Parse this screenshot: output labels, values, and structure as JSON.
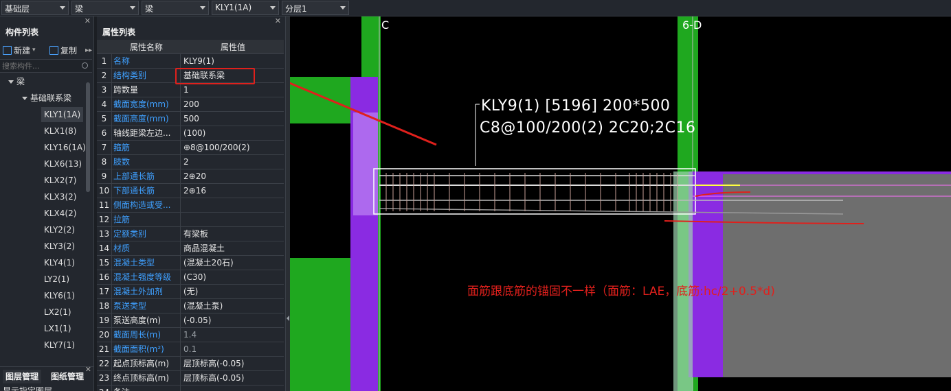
{
  "toolbar": {
    "floor": "基础层",
    "type": "梁",
    "subtype": "梁",
    "component": "KLY1(1A)",
    "layer": "分层1"
  },
  "component_panel": {
    "title": "构件列表",
    "new_label": "新建",
    "copy_label": "复制",
    "search_placeholder": "搜索构件...",
    "tree_root": "梁",
    "tree_group": "基础联系梁",
    "items": [
      "KLY1(1A)",
      "KLX1(8)",
      "KLY16(1A)",
      "KLX6(13)",
      "KLX2(7)",
      "KLX3(2)",
      "KLX4(2)",
      "KLY2(2)",
      "KLY3(2)",
      "KLY4(1)",
      "LY2(1)",
      "KLY6(1)",
      "LX2(1)",
      "LX1(1)",
      "KLY7(1)"
    ],
    "selected_item": "KLY1(1A)"
  },
  "bottom_tabs": {
    "tab1": "图层管理",
    "tab2": "图纸管理",
    "partial": "显示指定图层"
  },
  "property_panel": {
    "title": "属性列表",
    "col_name": "属性名称",
    "col_value": "属性值",
    "rows": [
      {
        "num": "1",
        "name": "名称",
        "value": "KLY9(1)",
        "name_blue": true
      },
      {
        "num": "2",
        "name": "结构类别",
        "value": "基础联系梁",
        "name_blue": true
      },
      {
        "num": "3",
        "name": "跨数量",
        "value": "1",
        "name_blue": false
      },
      {
        "num": "4",
        "name": "截面宽度(mm)",
        "value": "200",
        "name_blue": true
      },
      {
        "num": "5",
        "name": "截面高度(mm)",
        "value": "500",
        "name_blue": true
      },
      {
        "num": "6",
        "name": "轴线距梁左边...",
        "value": "(100)",
        "name_blue": false
      },
      {
        "num": "7",
        "name": "箍筋",
        "value": "⊕8@100/200(2)",
        "name_blue": true
      },
      {
        "num": "8",
        "name": "肢数",
        "value": "2",
        "name_blue": true
      },
      {
        "num": "9",
        "name": "上部通长筋",
        "value": "2⊕20",
        "name_blue": true
      },
      {
        "num": "10",
        "name": "下部通长筋",
        "value": "2⊕16",
        "name_blue": true
      },
      {
        "num": "11",
        "name": "侧面构造或受...",
        "value": "",
        "name_blue": true
      },
      {
        "num": "12",
        "name": "拉筋",
        "value": "",
        "name_blue": true
      },
      {
        "num": "13",
        "name": "定额类别",
        "value": "有梁板",
        "name_blue": true
      },
      {
        "num": "14",
        "name": "材质",
        "value": "商品混凝土",
        "name_blue": true
      },
      {
        "num": "15",
        "name": "混凝土类型",
        "value": "(混凝土20石)",
        "name_blue": true
      },
      {
        "num": "16",
        "name": "混凝土强度等级",
        "value": "(C30)",
        "name_blue": true
      },
      {
        "num": "17",
        "name": "混凝土外加剂",
        "value": "(无)",
        "name_blue": true
      },
      {
        "num": "18",
        "name": "泵送类型",
        "value": "(混凝土泵)",
        "name_blue": true
      },
      {
        "num": "19",
        "name": "泵送高度(m)",
        "value": "(-0.05)",
        "name_blue": false
      },
      {
        "num": "20",
        "name": "截面周长(m)",
        "value": "1.4",
        "name_blue": true,
        "value_gray": true
      },
      {
        "num": "21",
        "name": "截面面积(m²)",
        "value": "0.1",
        "name_blue": true,
        "value_gray": true
      },
      {
        "num": "22",
        "name": "起点顶标高(m)",
        "value": "层顶标高(-0.05)",
        "name_blue": false
      },
      {
        "num": "23",
        "name": "终点顶标高(m)",
        "value": "层顶标高(-0.05)",
        "name_blue": false
      },
      {
        "num": "24",
        "name": "备注",
        "value": "",
        "name_blue": false
      }
    ]
  },
  "canvas": {
    "axis_c": "C",
    "axis_6d": "6-D",
    "beam_label_line1": "KLY9(1) [5196] 200*500",
    "beam_label_line2": "C8@100/200(2) 2C20;2C16",
    "note": "面筋跟底筋的锚固不一样（面筋：LAE，底筋:hc/2+0.5*d)"
  },
  "colors": {
    "accent_blue": "#3fa0ff",
    "annotation_red": "#e0201c",
    "column_purple": "#8a2be2",
    "wall_green": "#1fa81f"
  }
}
